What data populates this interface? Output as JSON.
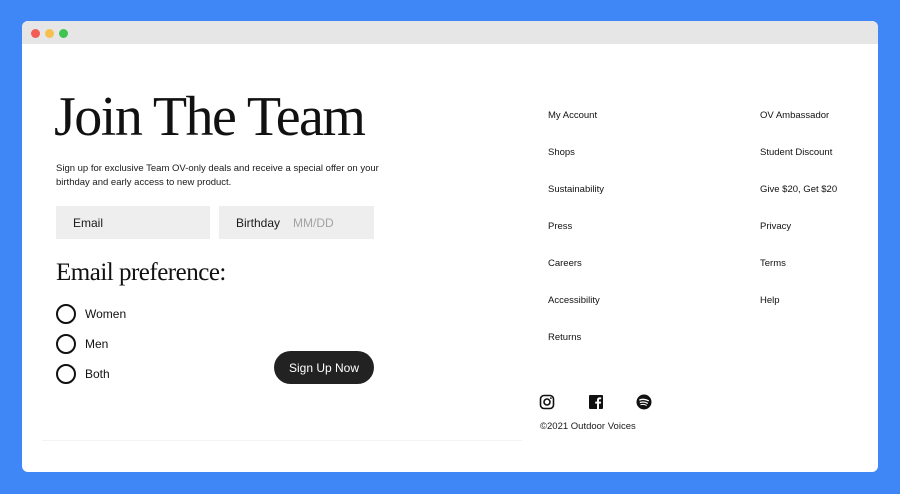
{
  "hero": {
    "title": "Join The Team",
    "description": "Sign up for exclusive Team OV-only deals and receive a special offer on your birthday and early access to new product."
  },
  "form": {
    "email_label": "Email",
    "birthday_label": "Birthday",
    "birthday_placeholder": "MM/DD",
    "preference_title": "Email preference:",
    "options": [
      "Women",
      "Men",
      "Both"
    ],
    "submit_label": "Sign Up Now"
  },
  "footer": {
    "column1": [
      "My Account",
      "Shops",
      "Sustainability",
      "Press",
      "Careers",
      "Accessibility",
      "Returns"
    ],
    "column2": [
      "OV Ambassador",
      "Student Discount",
      "Give $20, Get $20",
      "Privacy",
      "Terms",
      "Help"
    ],
    "social_icons": [
      "instagram-icon",
      "facebook-icon",
      "spotify-icon"
    ],
    "copyright": "©2021 Outdoor Voices"
  },
  "colors": {
    "background": "#3f86f7",
    "button": "#222222",
    "field": "#eeeeee",
    "placeholder": "#a3a3a3"
  }
}
